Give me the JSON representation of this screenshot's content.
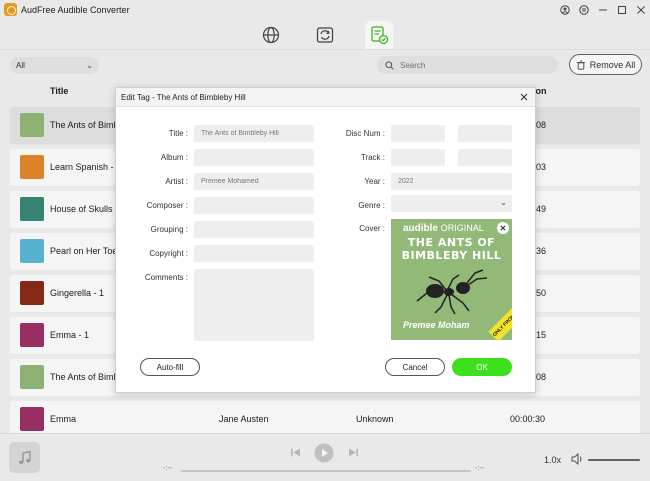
{
  "app": {
    "title": "AudFree Audible Converter"
  },
  "toolbar": {
    "filter_value": "All",
    "search_placeholder": "Search",
    "remove_all_label": "Remove All"
  },
  "list": {
    "header_title": "Title",
    "header_duration_partial": "ion",
    "rows": [
      {
        "title": "The Ants of Bimb",
        "author": "",
        "narrator": "",
        "duration": "08",
        "thumb_color": "#93b978"
      },
      {
        "title": "Learn Spanish - W",
        "author": "",
        "narrator": "",
        "duration": "03",
        "thumb_color": "#e88a2a"
      },
      {
        "title": "House of Skulls w",
        "author": "",
        "narrator": "",
        "duration": "49",
        "thumb_color": "#3a8a7a"
      },
      {
        "title": "Pearl on Her Toes",
        "author": "",
        "narrator": "",
        "duration": "36",
        "thumb_color": "#5bb8d8"
      },
      {
        "title": "Gingerella - 1",
        "author": "",
        "narrator": "",
        "duration": "50",
        "thumb_color": "#8a2a1a"
      },
      {
        "title": "Emma - 1",
        "author": "",
        "narrator": "",
        "duration": "15",
        "thumb_color": "#a0306a"
      },
      {
        "title": "The Ants of Bimb",
        "author": "",
        "narrator": "",
        "duration": "08",
        "thumb_color": "#93b978"
      },
      {
        "title": "Emma",
        "author": "Jane Austen",
        "narrator": "Unknown",
        "duration": "00:00:30",
        "thumb_color": "#a0306a"
      }
    ]
  },
  "player": {
    "time_left": "-:--",
    "time_right": "-:--",
    "speed": "1.0x"
  },
  "dialog": {
    "title": "Edit Tag - The Ants of Bimbleby Hill",
    "labels": {
      "title": "Title :",
      "album": "Album :",
      "artist": "Artist :",
      "composer": "Composer :",
      "grouping": "Grouping :",
      "copyright": "Copyright :",
      "comments": "Comments :",
      "disc_num": "Disc Num :",
      "track": "Track :",
      "year": "Year :",
      "genre": "Genre :",
      "cover": "Cover :"
    },
    "values": {
      "title": "The Ants of Bimbleby Hill",
      "album": "",
      "artist": "Premee Mohamed",
      "composer": "",
      "grouping": "",
      "copyright": "",
      "comments": "",
      "disc_num_a": "",
      "disc_num_b": "",
      "track_a": "",
      "track_b": "",
      "year": "2022",
      "genre": ""
    },
    "cover": {
      "brand": "audible",
      "brand_suffix": "ORIGINAL",
      "book_title_line1": "THE ANTS OF",
      "book_title_line2": "BIMBLEBY HILL",
      "author": "Premee Moham",
      "ribbon": "ONLY FROM audible"
    },
    "buttons": {
      "autofill": "Auto-fill",
      "cancel": "Cancel",
      "ok": "OK"
    }
  },
  "colors": {
    "accent_green": "#3ee01e",
    "cover_green": "#93b978",
    "app_logo": "#f0a020"
  }
}
